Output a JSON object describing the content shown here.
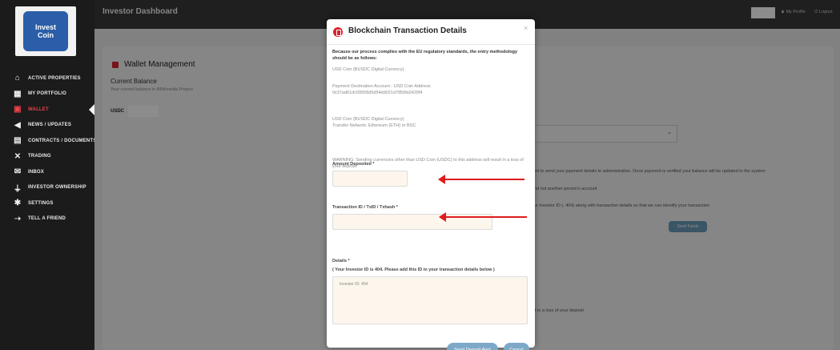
{
  "app": {
    "logo_text": "Invest\nCoin"
  },
  "sidebar": {
    "items": [
      {
        "label": "Active Properties",
        "icon": "bank-icon"
      },
      {
        "label": "My Portfolio",
        "icon": "grid-icon"
      },
      {
        "label": "Wallet",
        "icon": "wallet-icon",
        "active": true
      },
      {
        "label": "News / Updates",
        "icon": "megaphone-icon"
      },
      {
        "label": "Contracts / Documents",
        "icon": "document-icon"
      },
      {
        "label": "Trading",
        "icon": "exchange-icon"
      },
      {
        "label": "Inbox",
        "icon": "mail-icon"
      },
      {
        "label": "Investor Ownership",
        "icon": "plug-icon"
      },
      {
        "label": "Settings",
        "icon": "gear-icon"
      },
      {
        "label": "Tell a Friend",
        "icon": "share-icon"
      }
    ]
  },
  "header": {
    "title": "Investor Dashboard",
    "profile": "My Profile",
    "logout": "Logout"
  },
  "main": {
    "section_title": "Wallet Management",
    "balance_title": "Current Balance",
    "balance_sub": "Your current balance in BNKmedia Project",
    "currency_label": "USDC",
    "bg_text_1": "ment to send your payment details to administration. Once payment is verified your balance will be updated in the system",
    "bg_text_2": ", and not another person's account",
    "bg_text_3": "your Investor ID (. 404) along with transaction details so that we can identify your transaction",
    "bg_button": "Send Funds",
    "bg_text_4": "sult in a loss of your deposit"
  },
  "modal": {
    "title": "Blockchain Transaction Details",
    "close": "×",
    "intro": "Because our process complies with the EU regulatory standards, the entry methodology should be as follows:",
    "currency_line": "USD Coin (BUSDC Digital Currency)",
    "dest_label": "Payment Destination Account - USD Coin Address",
    "dest_address": "0x37ad61dc09558d5d54dd021d7856fa5420f4",
    "currency_line_2": "USD Coin (BUSDC Digital Currency)",
    "network_line": "Transfer Network: Ethereum (ETH) or BSC",
    "warning": "WARNING: Sending currencies other than USD Coin (USDC) to this address will result in a loss of your deposit.",
    "amount_label": "Amount Deposited *",
    "txid_label": "Transaction ID / TxID / Txhash *",
    "details_label": "Details *",
    "details_hint": "( Your Investor ID is 404. Please add this ID in your transaction details below )",
    "details_value": "Investor ID: 404",
    "send_button": "Send Deposit Alert",
    "cancel_button": "Cancel"
  },
  "colors": {
    "sidebar_bg": "#1b1b1b",
    "active_red": "#e8434a",
    "button_blue": "#7ea8c8",
    "arrow_red": "#e01b1b"
  }
}
